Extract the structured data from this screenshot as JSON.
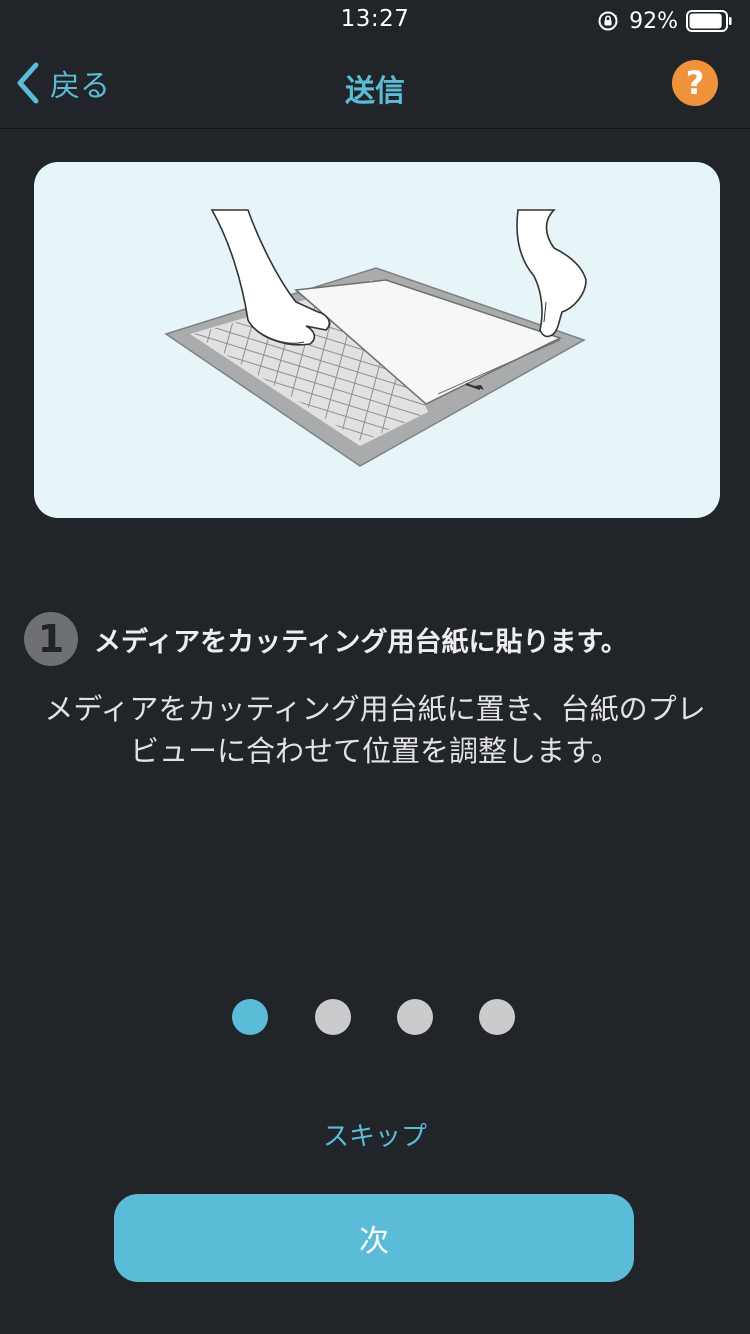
{
  "status_bar": {
    "time": "13:27",
    "battery_percent": "92%",
    "battery_level": 0.92,
    "icons": [
      "lock-rotation-icon",
      "battery-icon"
    ]
  },
  "nav": {
    "back_label": "戻る",
    "title": "送信",
    "help_symbol": "?"
  },
  "illustration": {
    "icon": "cutting-mat-illustration",
    "background_color": "#e7f4f8"
  },
  "step": {
    "number": "1",
    "title": "メディアをカッティング用台紙に貼ります。",
    "description_lines": [
      "メディアをカッティング用台紙に置き、台紙のプレ",
      "ビューに合わせて位置を調整します。"
    ]
  },
  "pagination": {
    "count": 4,
    "active_index": 0
  },
  "actions": {
    "skip_label": "スキップ",
    "next_label": "次"
  },
  "colors": {
    "background": "#212428",
    "accent": "#5bbcd8",
    "help": "#f0923a",
    "dot_inactive": "#cbcbcd"
  }
}
